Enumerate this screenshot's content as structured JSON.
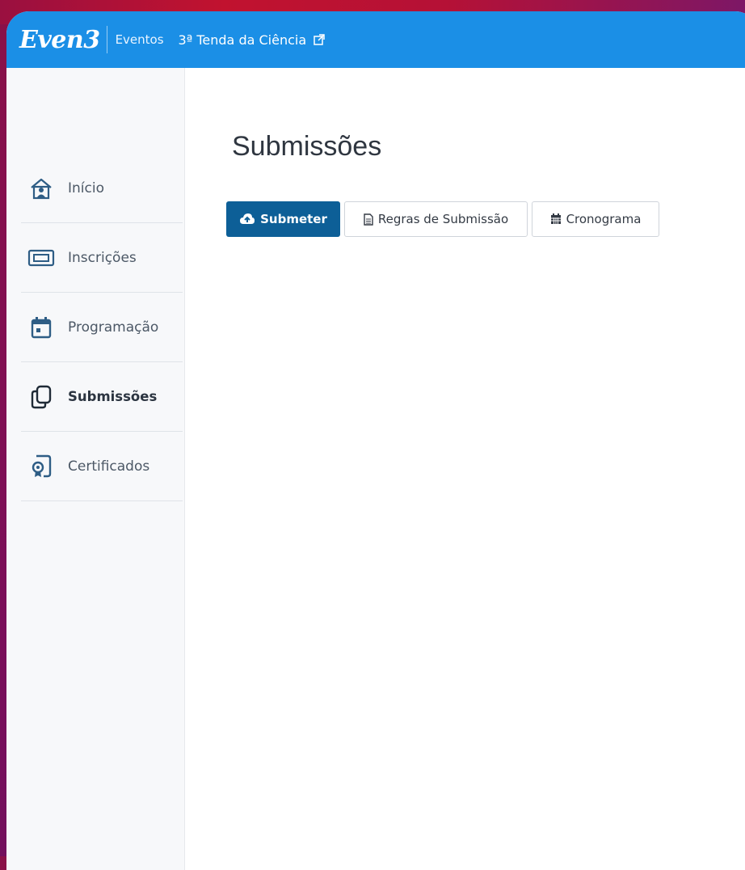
{
  "header": {
    "logo_text": "Even3",
    "events_link": "Eventos",
    "event_name": "3ª Tenda da Ciência",
    "external_icon": "external-link-icon"
  },
  "sidebar": {
    "items": [
      {
        "label": "Início",
        "icon": "home-user-icon"
      },
      {
        "label": "Inscrições",
        "icon": "ticket-icon"
      },
      {
        "label": "Programação",
        "icon": "calendar-icon"
      },
      {
        "label": "Submissões",
        "icon": "copy-files-icon",
        "active": true
      },
      {
        "label": "Certificados",
        "icon": "certificate-icon"
      }
    ]
  },
  "main": {
    "title": "Submissões",
    "buttons": {
      "submit": {
        "label": "Submeter",
        "icon": "cloud-upload-icon"
      },
      "rules": {
        "label": "Regras de Submissão",
        "icon": "document-icon"
      },
      "schedule": {
        "label": "Cronograma",
        "icon": "calendar-grid-icon"
      }
    }
  },
  "colors": {
    "topbar": "#1b8fe6",
    "primary_button": "#0d5f97",
    "background_gradient": "#8a1148"
  }
}
